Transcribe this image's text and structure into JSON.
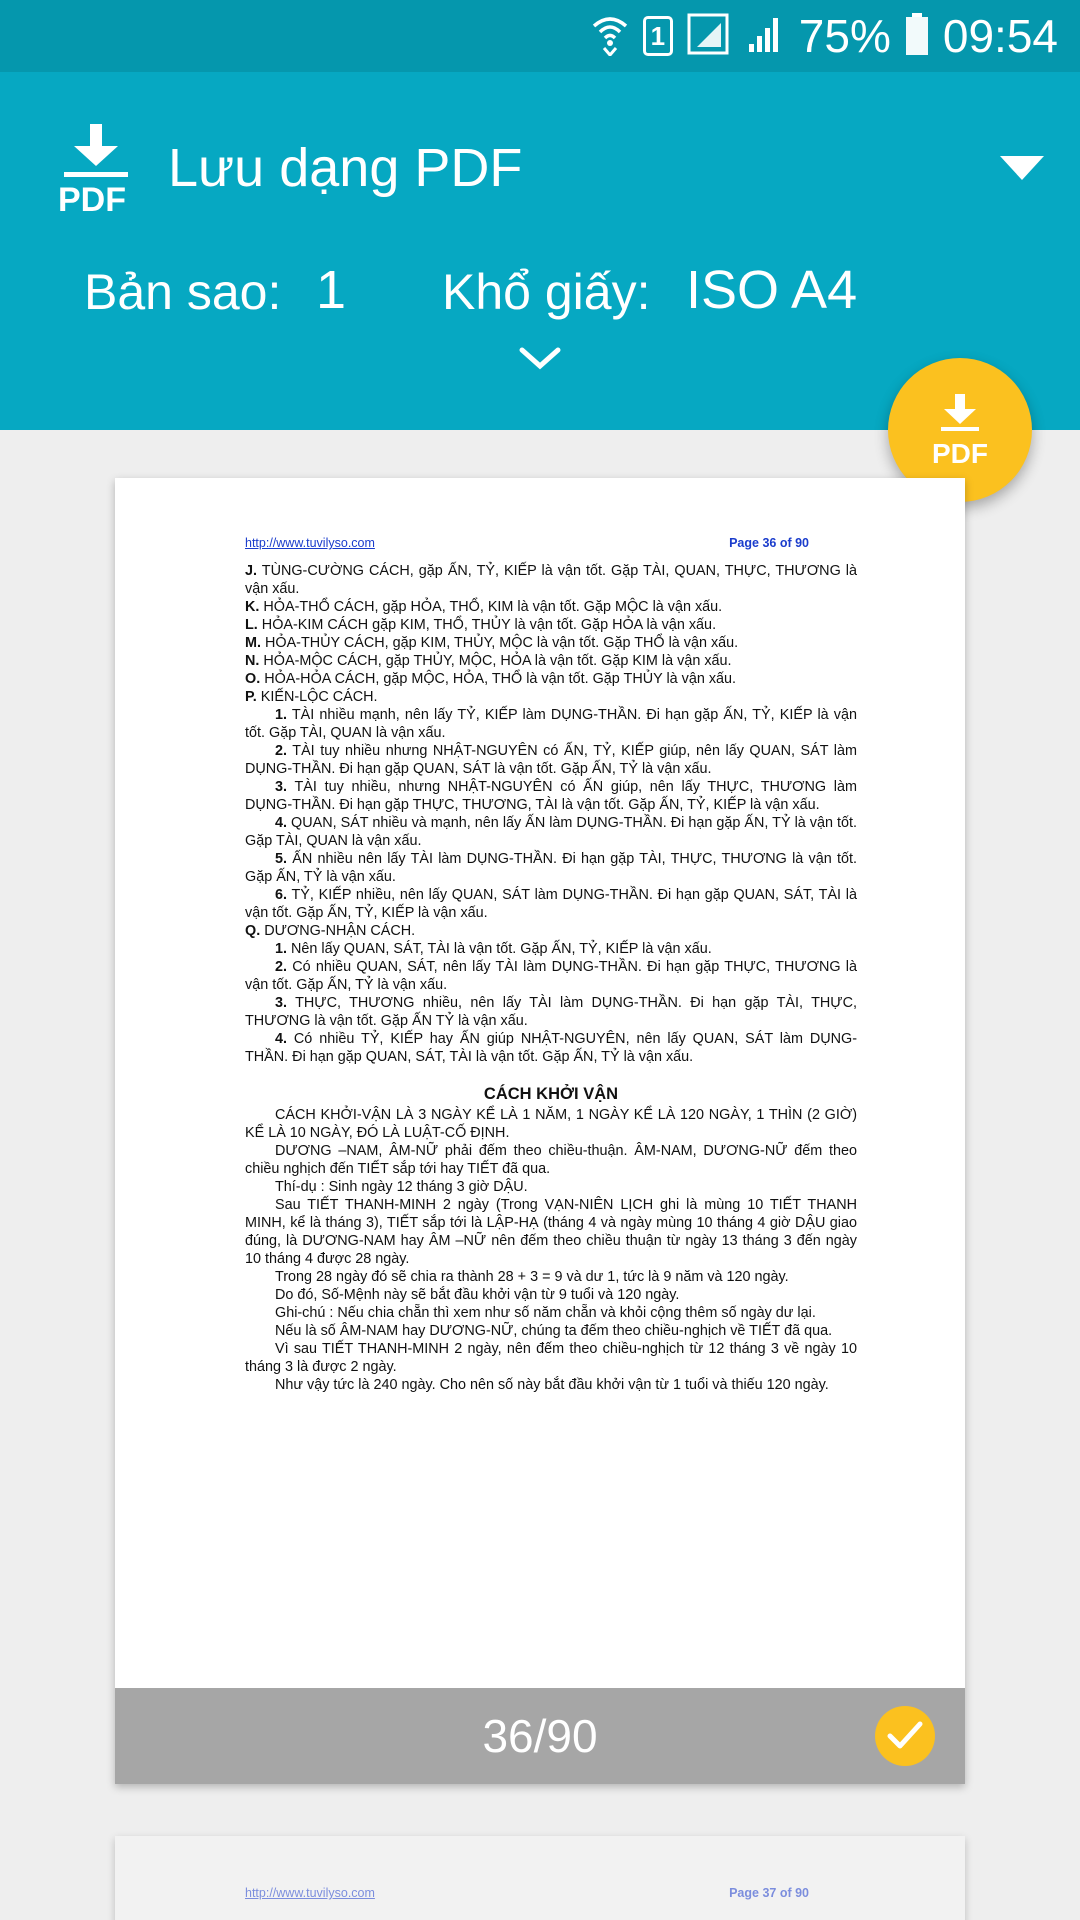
{
  "status_bar": {
    "wifi_icon": "wifi-icon",
    "sim_badge": "1",
    "battery_percent": "75%",
    "time": "09:54"
  },
  "app_bar": {
    "logo_icon": "download-pdf-icon",
    "logo_text": "PDF",
    "title": "Lưu dạng PDF",
    "copies_label": "Bản sao:",
    "copies_value": "1",
    "paper_label": "Khổ giấy:",
    "paper_value": "ISO A4"
  },
  "fab": {
    "label": "PDF",
    "icon": "download-pdf-icon"
  },
  "preview": {
    "page_counter": "36/90",
    "current_page": {
      "header_link": "http://www.tuvilyso.com",
      "header_page": "Page 36 of 90",
      "lines": [
        {
          "style": "plain",
          "b": "J.",
          "t": " TÙNG-CƯỜNG CÁCH, gặp ẤN, TỶ, KIẾP là vận tốt. Gặp TÀI, QUAN, THỰC, THƯƠNG là vận xấu."
        },
        {
          "style": "plain",
          "b": "K.",
          "t": " HỎA-THỔ CÁCH, gặp HỎA, THỔ, KIM là vận tốt. Gặp MỘC là vận xấu."
        },
        {
          "style": "plain",
          "b": "L.",
          "t": " HỎA-KIM CÁCH gặp KIM, THỔ, THỦY là vận tốt. Gặp HỎA là vận xấu."
        },
        {
          "style": "plain",
          "b": "M.",
          "t": " HỎA-THỦY CÁCH, gặp KIM, THỦY, MỘC là vận tốt. Gặp THỔ là vận xấu."
        },
        {
          "style": "plain",
          "b": "N.",
          "t": " HỎA-MỘC CÁCH, gặp THỦY, MỘC, HỎA là vận tốt. Gặp KIM là vận xấu."
        },
        {
          "style": "plain",
          "b": "O.",
          "t": " HỎA-HỎA CÁCH, gặp MỘC, HỎA, THỔ là vận tốt. Gặp THỦY là vận xấu."
        },
        {
          "style": "plain",
          "b": "P.",
          "t": " KIẾN-LỘC CÁCH."
        },
        {
          "style": "ind",
          "b": "1.",
          "t": " TÀI nhiều mạnh, nên lấy TỶ, KIẾP làm DỤNG-THẦN. Đi hạn gặp ẤN, TỶ, KIẾP là vận tốt. Gặp TÀI, QUAN là vận xấu."
        },
        {
          "style": "ind",
          "b": "2.",
          "t": " TÀI tuy nhiều nhưng NHẬT-NGUYÊN có ẤN, TỶ, KIẾP giúp, nên lấy QUAN, SÁT làm DỤNG-THẦN. Đi hạn gặp QUAN, SÁT là vận tốt. Gặp ẤN, TỶ là vận xấu."
        },
        {
          "style": "ind",
          "b": "3.",
          "t": " TÀI tuy nhiều, nhưng NHẬT-NGUYÊN có ẤN giúp, nên lấy THỰC, THƯƠNG làm DỤNG-THẦN. Đi hạn gặp THỰC, THƯƠNG, TÀI là vận tốt. Gặp ẤN, TỶ, KIẾP là vận xấu."
        },
        {
          "style": "ind",
          "b": "4.",
          "t": " QUAN, SÁT nhiều và mạnh, nên lấy ẤN làm DỤNG-THẦN. Đi hạn gặp ẤN, TỶ là vận tốt. Gặp TÀI, QUAN là vận xấu."
        },
        {
          "style": "ind",
          "b": "5.",
          "t": " ẤN nhiều nên lấy TÀI làm DỤNG-THẦN. Đi hạn gặp TÀI, THỰC, THƯƠNG là vận tốt. Gặp ẤN, TỶ là vận xấu."
        },
        {
          "style": "ind",
          "b": "6.",
          "t": " TỶ, KIẾP nhiều, nên lấy QUAN, SÁT làm DỤNG-THẦN. Đi hạn gặp QUAN, SÁT, TÀI là vận tốt. Gặp ẤN, TỶ, KIẾP là vận xấu."
        },
        {
          "style": "plain",
          "b": "Q.",
          "t": " DƯƠNG-NHẬN CÁCH."
        },
        {
          "style": "ind",
          "b": "1.",
          "t": " Nên lấy QUAN, SÁT, TÀI là vận tốt. Gặp ẤN, TỶ, KIẾP là vận xấu."
        },
        {
          "style": "ind",
          "b": "2.",
          "t": " Có nhiều QUAN, SÁT, nên lấy TÀI làm DỤNG-THẦN. Đi hạn gặp THỰC, THƯƠNG là vận tốt. Gặp ẤN, TỶ là vận xấu."
        },
        {
          "style": "ind",
          "b": "3.",
          "t": " THỰC, THƯƠNG nhiều, nên lấy TÀI làm DỤNG-THẦN. Đi hạn gặp TÀI, THỰC, THƯƠNG là vận tốt. Gặp ẤN TỶ là vận xấu."
        },
        {
          "style": "ind",
          "b": "4.",
          "t": " Có nhiều TỶ, KIẾP hay ẤN giúp NHẬT-NGUYÊN, nên lấy QUAN, SÁT làm DỤNG-THẦN. Đi hạn gặp QUAN, SÁT, TÀI là vận tốt. Gặp ẤN, TỶ là vận xấu."
        },
        {
          "style": "heading",
          "b": "",
          "t": "CÁCH KHỞI VẬN"
        },
        {
          "style": "ind",
          "b": "",
          "t": "CÁCH KHỞI-VẬN LÀ 3 NGÀY KỂ LÀ 1 NĂM, 1 NGÀY KỂ LÀ 120 NGÀY, 1 THÌN (2 GIỜ) KỂ LÀ 10 NGÀY, ĐÓ LÀ LUẬT-CỐ ĐỊNH."
        },
        {
          "style": "ind",
          "b": "",
          "t": "DƯƠNG –NAM, ÂM-NỮ phải đếm theo chiều-thuận. ÂM-NAM, DƯƠNG-NỮ đếm theo chiều nghịch đến TIẾT sắp tới hay TIẾT đã qua."
        },
        {
          "style": "ind",
          "b": "",
          "t": "Thí-dụ : Sinh ngày 12 tháng 3 giờ DẬU."
        },
        {
          "style": "ind",
          "b": "",
          "t": "Sau TIẾT THANH-MINH 2 ngày (Trong VẠN-NIÊN LỊCH ghi là mùng 10 TIẾT THANH MINH, kể là tháng 3), TIẾT sắp tới là LẬP-HẠ (tháng 4 và ngày mùng 10 tháng 4 giờ DẬU giao đúng, là DƯƠNG-NAM hay ÂM –NỮ nên đếm theo chiều thuận từ ngày 13 tháng 3 đến ngày 10 tháng 4 được 28 ngày."
        },
        {
          "style": "ind",
          "b": "",
          "t": "Trong 28 ngày đó sẽ chia ra thành 28 + 3 = 9 và dư 1, tức là 9 năm và 120 ngày."
        },
        {
          "style": "ind",
          "b": "",
          "t": "Do đó, Số-Mệnh này sẽ bắt đầu khởi vận từ 9 tuổi và 120 ngày."
        },
        {
          "style": "ind",
          "b": "",
          "t": "Ghi-chú : Nếu chia chẵn thì xem như số năm chẵn và khỏi cộng thêm số ngày dư lại."
        },
        {
          "style": "ind",
          "b": "",
          "t": "Nếu là số ÂM-NAM hay DƯƠNG-NỮ, chúng ta đếm theo chiều-nghịch về TIẾT đã qua."
        },
        {
          "style": "ind",
          "b": "",
          "t": "Vì sau TIẾT THANH-MINH 2 ngày, nên đếm theo chiều-nghịch từ 12 tháng 3 về ngày 10 tháng 3 là được 2 ngày."
        },
        {
          "style": "ind",
          "b": "",
          "t": "Như vậy tức là 240 ngày. Cho nên số này bắt đầu khởi vận từ 1 tuổi và thiếu 120 ngày."
        }
      ]
    },
    "next_page": {
      "header_link": "http://www.tuvilyso.com",
      "header_page": "Page 37 of 90"
    }
  },
  "colors": {
    "status_bar": "#0597ad",
    "app_bar": "#06a8c2",
    "fab": "#fbc11f",
    "page_footer": "#a6a6a6",
    "background": "#eeeeee"
  }
}
